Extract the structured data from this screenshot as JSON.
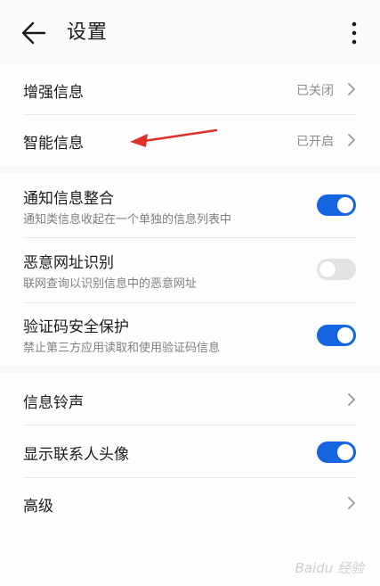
{
  "header": {
    "title": "设置",
    "back_icon": "back-arrow-icon",
    "more_icon": "more-vertical-icon"
  },
  "section1": {
    "items": [
      {
        "label": "增强信息",
        "value": "已关闭"
      },
      {
        "label": "智能信息",
        "value": "已开启"
      }
    ]
  },
  "section2": {
    "items": [
      {
        "label": "通知信息整合",
        "sub": "通知类信息收起在一个单独的信息列表中",
        "enabled": true
      },
      {
        "label": "恶意网址识别",
        "sub": "联网查询以识别信息中的恶意网址",
        "enabled": false
      },
      {
        "label": "验证码安全保护",
        "sub": "禁止第三方应用读取和使用验证码信息",
        "enabled": true
      }
    ]
  },
  "section3": {
    "items": [
      {
        "label": "信息铃声"
      },
      {
        "label": "显示联系人头像",
        "enabled": true
      },
      {
        "label": "高级"
      }
    ]
  },
  "colors": {
    "accent": "#1565e0",
    "annotation_arrow": "#e0302a",
    "background": "#f7f7f7"
  },
  "watermark": "Baidu 经验"
}
